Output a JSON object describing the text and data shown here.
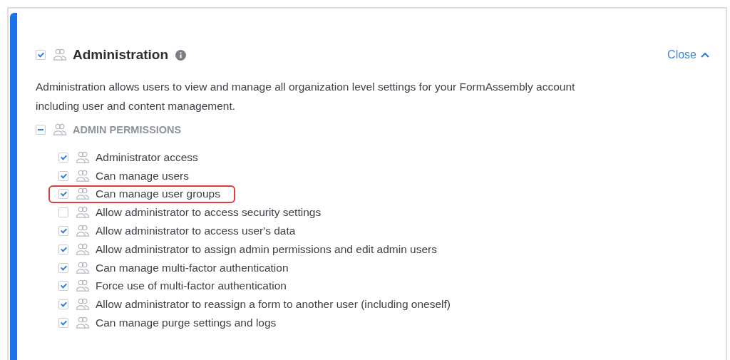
{
  "section": {
    "title": "Administration",
    "checked": true,
    "close_label": "Close",
    "description": "Administration allows users to view and manage all organization level settings for your FormAssembly account including user and content management.",
    "group": {
      "label": "ADMIN PERMISSIONS",
      "partially_checked": true,
      "permissions": [
        {
          "label": "Administrator access",
          "checked": true,
          "highlighted": false
        },
        {
          "label": "Can manage users",
          "checked": true,
          "highlighted": false
        },
        {
          "label": "Can manage user groups",
          "checked": true,
          "highlighted": true
        },
        {
          "label": "Allow administrator to access security settings",
          "checked": false,
          "highlighted": false
        },
        {
          "label": "Allow administrator to access user's data",
          "checked": true,
          "highlighted": false
        },
        {
          "label": "Allow administrator to assign admin permissions and edit admin users",
          "checked": true,
          "highlighted": false
        },
        {
          "label": "Can manage multi-factor authentication",
          "checked": true,
          "highlighted": false
        },
        {
          "label": "Force use of multi-factor authentication",
          "checked": true,
          "highlighted": false
        },
        {
          "label": "Allow administrator to reassign a form to another user (including oneself)",
          "checked": true,
          "highlighted": false
        },
        {
          "label": "Can manage purge settings and logs",
          "checked": true,
          "highlighted": false
        }
      ]
    }
  }
}
